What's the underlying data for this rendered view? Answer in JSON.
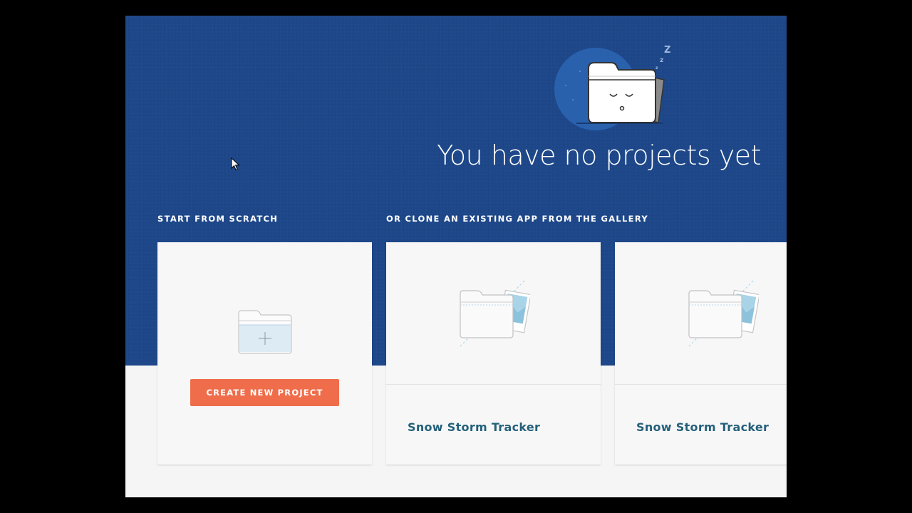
{
  "hero": {
    "title": "You have no projects yet",
    "background_color": "#1d4789"
  },
  "sections": {
    "scratch_label": "START FROM SCRATCH",
    "gallery_label": "OR CLONE AN EXISTING APP FROM THE GALLERY"
  },
  "scratch_card": {
    "button_label": "CREATE NEW PROJECT",
    "icon": "new-folder-plus-icon",
    "button_color": "#ef6d4b"
  },
  "gallery": [
    {
      "title": "Snow Storm Tracker",
      "icon": "folder-with-image-icon"
    },
    {
      "title": "Snow Storm Tracker",
      "icon": "folder-with-image-icon"
    }
  ],
  "colors": {
    "accent": "#ef6d4b",
    "link": "#24607a",
    "page_background": "#f5f5f5"
  }
}
